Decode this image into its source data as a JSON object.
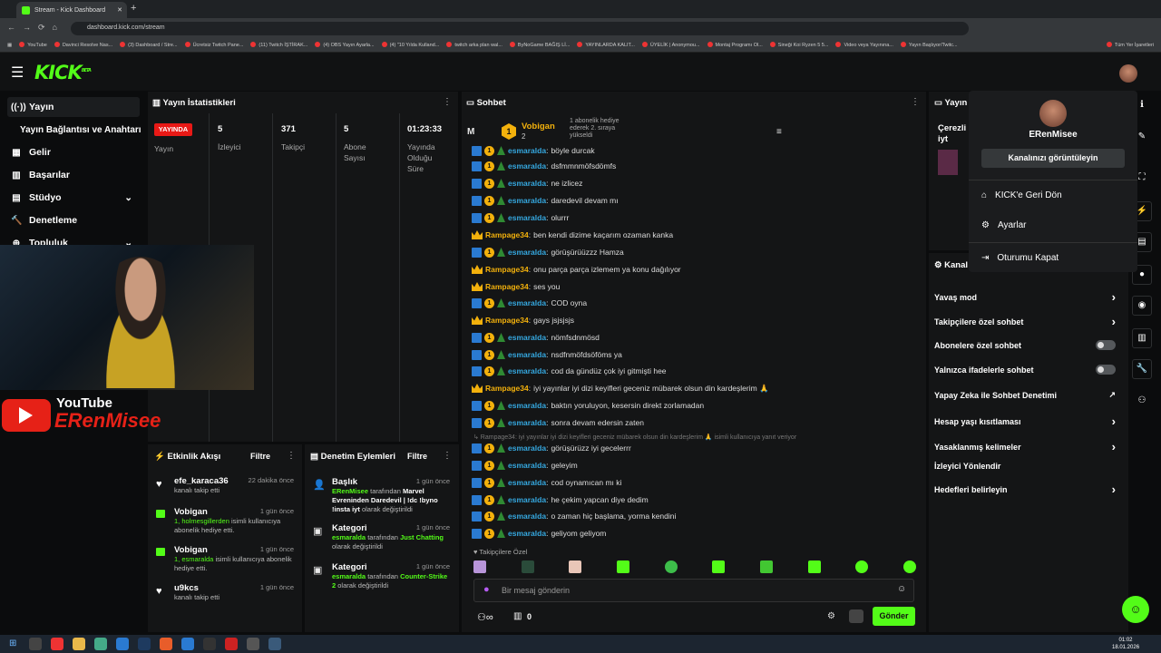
{
  "browser": {
    "tab_title": "Stream - Kick Dashboard",
    "url": "dashboard.kick.com/stream",
    "bookmarks": [
      "YouTube",
      "Davinci Resolve Nas...",
      "(3) Dashboard / Stre...",
      "Ücretsiz Twitch Pane...",
      "(11) Twitch İŞTİRAK...",
      "(4) OBS Yayın Ayarla...",
      "(4) \"10 Yılda Kulland...",
      "twitch arka plan wal...",
      "ByNoGame BAĞIŞ Lİ...",
      "YAYINLARDA KALIT...",
      "ÜYELİK | Anonymou...",
      "Montaj Programı Ol...",
      "Sineği Koi Ryzen 5 5...",
      "Video veya Yayınına...",
      "Yayın Başlıyor/Twitc...",
      "Tüm Yer İşaretleri"
    ]
  },
  "header": {
    "logo": "KICK",
    "logo_beta": "BETA"
  },
  "sidebar": {
    "items": [
      {
        "label": "Yayın",
        "icon": "broadcast-icon"
      },
      {
        "label": "Yayın Bağlantısı ve Anahtarı"
      },
      {
        "label": "Gelir",
        "icon": "money-icon"
      },
      {
        "label": "Başarılar",
        "icon": "trophy-icon"
      },
      {
        "label": "Stüdyo",
        "icon": "studio-icon"
      },
      {
        "label": "Denetleme",
        "icon": "hammer-icon"
      },
      {
        "label": "Topluluk",
        "icon": "community-icon"
      }
    ]
  },
  "stats": {
    "title": "Yayın İstatistikleri",
    "live_badge": "YAYINDA",
    "live_label": "Yayın",
    "viewers": "5",
    "viewers_label": "İzleyici",
    "followers": "371",
    "followers_label": "Takipçi",
    "subs": "5",
    "subs_label": "Abone Sayısı",
    "duration": "01:23:33",
    "duration_label": "Yayında Olduğu Süre"
  },
  "overlay": {
    "yt_word": "YouTube",
    "channel": "ERenMisee"
  },
  "activity": {
    "title": "Etkinlik Akışı",
    "filter": "Filtre",
    "items": [
      {
        "name": "efe_karaca36",
        "time": "22 dakika önce",
        "desc": "kanalı takip etti"
      },
      {
        "name": "Vobigan",
        "time": "1 gün önce",
        "hl": "1, holmesgillerden",
        "desc": "isimli kullanıcıya abonelik hediye etti."
      },
      {
        "name": "Vobigan",
        "time": "1 gün önce",
        "hl": "1, esmaralda",
        "desc": "isimli kullanıcıya abonelik hediye etti."
      },
      {
        "name": "u9kcs",
        "time": "1 gün önce",
        "desc": "kanalı takip etti"
      }
    ]
  },
  "moderation": {
    "title": "Denetim Eylemleri",
    "filter": "Filtre",
    "items": [
      {
        "title": "Başlık",
        "time": "1 gün önce",
        "actor": "ERenMisee",
        "mid": "tarafından",
        "value": "Marvel Evreninden Daredevil | !dc !byno !insta iyt",
        "tail": "olarak değiştirildi"
      },
      {
        "title": "Kategori",
        "time": "1 gün önce",
        "actor": "esmaralda",
        "mid": "tarafından",
        "value": "Just Chatting",
        "tail": "olarak değiştirildi"
      },
      {
        "title": "Kategori",
        "time": "1 gün önce",
        "actor": "esmaralda",
        "mid": "tarafından",
        "value": "Counter-Strike 2",
        "tail": "olarak değiştirildi"
      }
    ]
  },
  "chat": {
    "title": "Sohbet",
    "pinned_initial": "M",
    "gifter": "Vobigan",
    "gift_count": "2",
    "gift_text": "1 abonelik hediye ederek 2. sıraya yükseldi",
    "messages": [
      {
        "user": "esmaralda",
        "text": "böyle durcak"
      },
      {
        "user": "esmaralda",
        "text": "dsfmmnmöfsdömfs"
      },
      {
        "user": "esmaralda",
        "text": "ne izlicez"
      },
      {
        "user": "esmaralda",
        "text": "daredevil devam mı"
      },
      {
        "user": "esmaralda",
        "text": "olurrr"
      },
      {
        "user": "Rampage34",
        "text": "ben kendi dizime kaçarım ozaman kanka"
      },
      {
        "user": "esmaralda",
        "text": "görüşürüüzzz Hamza"
      },
      {
        "user": "Rampage34",
        "text": "onu parça parça izlemem ya konu dağılıyor"
      },
      {
        "user": "Rampage34",
        "text": "ses you"
      },
      {
        "user": "esmaralda",
        "text": "COD oyna"
      },
      {
        "user": "Rampage34",
        "text": "gays jsjsjsjs"
      },
      {
        "user": "esmaralda",
        "text": "nömfsdnmösd"
      },
      {
        "user": "esmaralda",
        "text": "nsdfnmöfdsöföms ya"
      },
      {
        "user": "esmaralda",
        "text": "cod da gündüz çok iyi gitmişti hee"
      },
      {
        "user": "Rampage34",
        "text": "iyi yayınlar iyi dizi keyifleri geceniz mübarek olsun din kardeşlerim 🙏"
      },
      {
        "user": "esmaralda",
        "text": "baktın yoruluyon, kesersin direkt zorlamadan"
      },
      {
        "user": "esmaralda",
        "text": "sonra devam edersin zaten"
      },
      {
        "user": "esmaralda",
        "text": "görüşürüzz iyi gecelerrr"
      },
      {
        "user": "esmaralda",
        "text": "geleyim"
      },
      {
        "user": "esmaralda",
        "text": "cod oynamıcan mı ki"
      },
      {
        "user": "esmaralda",
        "text": "he çekim yapcan diye dedim"
      },
      {
        "user": "esmaralda",
        "text": "o zaman hiç başlama, yorma kendini"
      },
      {
        "user": "esmaralda",
        "text": "geliyom geliyom"
      }
    ],
    "reply_preview": "↳ Rampage34: iyi yayınlar iyi dizi keyifleri geceniz mübarek olsun din kardeşlerim 🙏 isimli kullanıcıya yanıt veriyor",
    "followers_only": "Takipçilere Özel",
    "placeholder": "Bir mesaj gönderin",
    "count": "0",
    "send": "Gönder"
  },
  "right_panel": {
    "title": "Yayın",
    "reward_title": "Çerezli iyt",
    "channel_settings": "Kanal",
    "mods": [
      {
        "label": "Yavaş mod",
        "type": "arrow"
      },
      {
        "label": "Takipçilere özel sohbet",
        "type": "arrow"
      },
      {
        "label": "Abonelere özel sohbet",
        "type": "toggle"
      },
      {
        "label": "Yalnızca ifadelerle sohbet",
        "type": "toggle"
      },
      {
        "label": "Yapay Zeka ile Sohbet Denetimi",
        "type": "ext"
      },
      {
        "label": "Hesap yaşı kısıtlaması",
        "type": "arrow"
      },
      {
        "label": "Yasaklanmış kelimeler",
        "type": "arrow"
      },
      {
        "label": "İzleyici Yönlendir",
        "type": "none"
      },
      {
        "label": "Hedefleri belirleyin",
        "type": "arrow"
      }
    ]
  },
  "dropdown": {
    "username": "ERenMisee",
    "view_channel": "Kanalınızı görüntüleyin",
    "items": [
      {
        "label": "KICK'e Geri Dön",
        "icon": "home-icon"
      },
      {
        "label": "Ayarlar",
        "icon": "gear-icon"
      },
      {
        "label": "Oturumu Kapat",
        "icon": "logout-icon"
      }
    ]
  },
  "taskbar": {
    "time": "01:02",
    "date": "18.01.2026"
  },
  "colors": {
    "brand": "#53fc18",
    "live": "#e91916",
    "esmaralda": "#35a8e0",
    "rampage": "#f3b10c"
  }
}
